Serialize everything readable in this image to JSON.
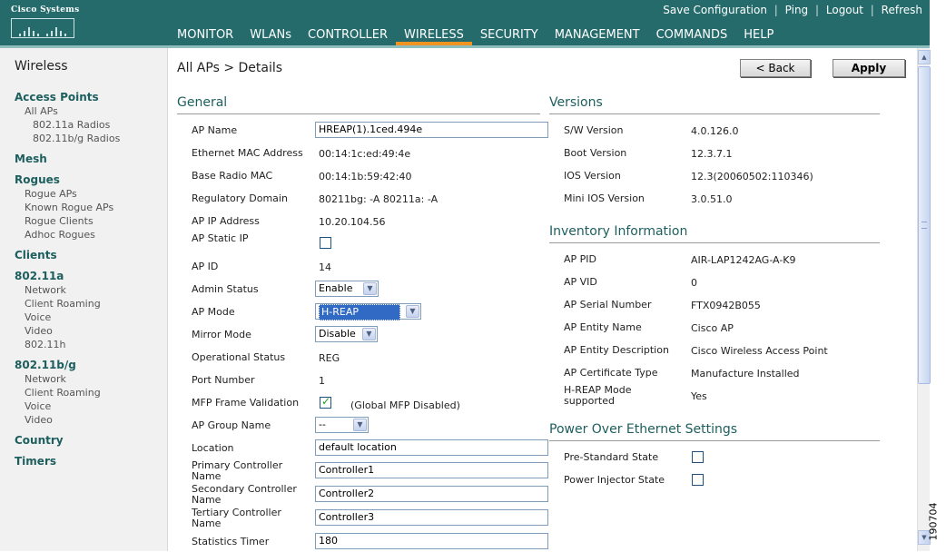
{
  "brand": {
    "logo_text": "Cisco Systems"
  },
  "util_links": [
    "Save Configuration",
    "Ping",
    "Logout",
    "Refresh"
  ],
  "nav": [
    "MONITOR",
    "WLANs",
    "CONTROLLER",
    "WIRELESS",
    "SECURITY",
    "MANAGEMENT",
    "COMMANDS",
    "HELP"
  ],
  "active_nav": "WIRELESS",
  "sidebar": {
    "title": "Wireless",
    "access_points": "Access Points",
    "all_aps": "All APs",
    "radio_a": "802.11a Radios",
    "radio_bg": "802.11b/g Radios",
    "mesh": "Mesh",
    "rogues": "Rogues",
    "rogue_aps": "Rogue APs",
    "known_rogue_aps": "Known Rogue APs",
    "rogue_clients": "Rogue Clients",
    "adhoc_rogues": "Adhoc Rogues",
    "clients": "Clients",
    "a": "802.11a",
    "a_network": "Network",
    "a_client_roaming": "Client Roaming",
    "a_voice": "Voice",
    "a_video": "Video",
    "a_80211h": "802.11h",
    "bg": "802.11b/g",
    "bg_network": "Network",
    "bg_client_roaming": "Client Roaming",
    "bg_voice": "Voice",
    "bg_video": "Video",
    "country": "Country",
    "timers": "Timers"
  },
  "breadcrumb": "All APs > Details",
  "buttons": {
    "back": "< Back",
    "apply": "Apply"
  },
  "general": {
    "title": "General",
    "ap_name_label": "AP Name",
    "ap_name": "HREAP(1).1ced.494e",
    "eth_mac_label": "Ethernet MAC Address",
    "eth_mac": "00:14:1c:ed:49:4e",
    "base_mac_label": "Base Radio MAC",
    "base_mac": "00:14:1b:59:42:40",
    "reg_domain_label": "Regulatory Domain",
    "reg_domain": "80211bg: -A 80211a: -A",
    "ip_label": "AP IP Address",
    "ip": "10.20.104.56",
    "static_ip_label": "AP Static IP",
    "static_ip_checked": false,
    "ap_id_label": "AP ID",
    "ap_id": "14",
    "admin_status_label": "Admin Status",
    "admin_status": "Enable",
    "ap_mode_label": "AP Mode",
    "ap_mode": "H-REAP",
    "mirror_label": "Mirror Mode",
    "mirror": "Disable",
    "op_status_label": "Operational Status",
    "op_status": "REG",
    "port_label": "Port Number",
    "port": "1",
    "mfp_label": "MFP Frame Validation",
    "mfp_checked": true,
    "mfp_note": "(Global MFP Disabled)",
    "group_label": "AP Group Name",
    "group": "--",
    "location_label": "Location",
    "location": "default location",
    "primary_label": "Primary Controller Name",
    "primary": "Controller1",
    "secondary_label": "Secondary Controller Name",
    "secondary": "Controller2",
    "tertiary_label": "Tertiary Controller Name",
    "tertiary": "Controller3",
    "stats_label": "Statistics Timer",
    "stats": "180"
  },
  "versions": {
    "title": "Versions",
    "sw_label": "S/W Version",
    "sw": "4.0.126.0",
    "boot_label": "Boot Version",
    "boot": "12.3.7.1",
    "ios_label": "IOS Version",
    "ios": "12.3(20060502:110346)",
    "mini_ios_label": "Mini IOS Version",
    "mini_ios": "3.0.51.0"
  },
  "inventory": {
    "title": "Inventory Information",
    "pid_label": "AP PID",
    "pid": "AIR-LAP1242AG-A-K9",
    "vid_label": "AP VID",
    "vid": "0",
    "serial_label": "AP Serial Number",
    "serial": "FTX0942B055",
    "entity_name_label": "AP Entity Name",
    "entity_name": "Cisco AP",
    "entity_desc_label": "AP Entity Description",
    "entity_desc": "Cisco Wireless Access Point",
    "cert_label": "AP Certificate Type",
    "cert": "Manufacture Installed",
    "hreap_label": "H-REAP Mode supported",
    "hreap": "Yes"
  },
  "poe": {
    "title": "Power Over Ethernet Settings",
    "prestd_label": "Pre-Standard State",
    "prestd_checked": false,
    "injector_label": "Power Injector State",
    "injector_checked": false
  },
  "figure_number": "190704"
}
